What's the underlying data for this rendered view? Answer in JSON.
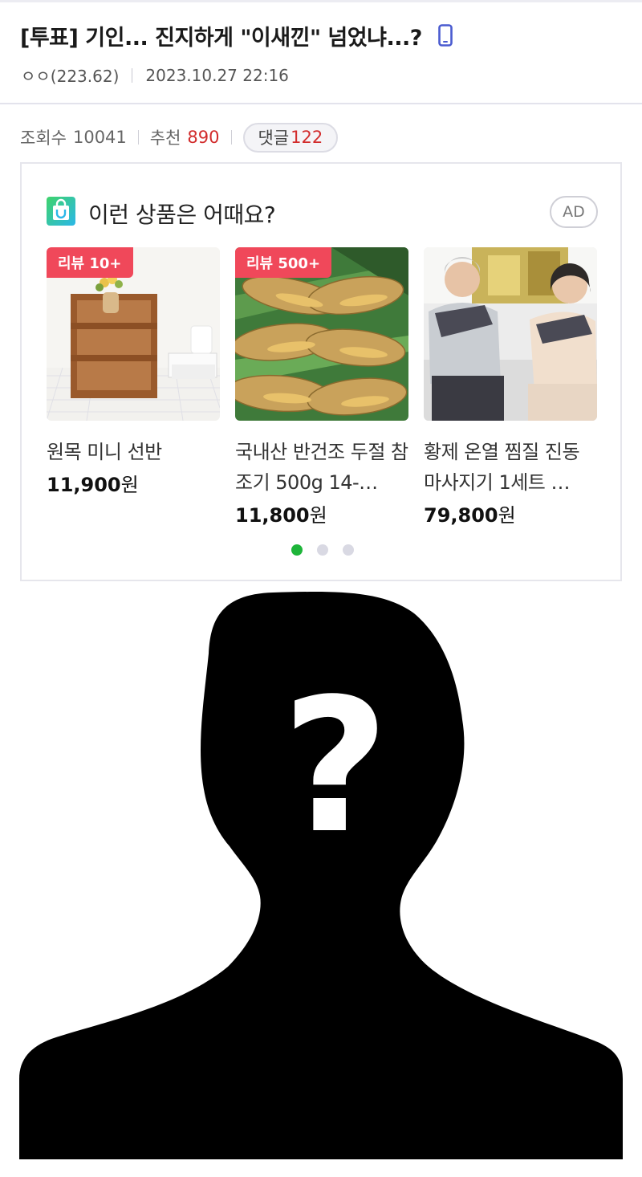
{
  "post": {
    "title": "[투표] 기인... 진지하게 \"이새낀\" 넘었냐...?",
    "author": "ㅇㅇ(223.62)",
    "datetime": "2023.10.27 22:16",
    "device_icon": "mobile-phone-icon"
  },
  "stats": {
    "views_label": "조회수",
    "views": "10041",
    "recommend_label": "추천",
    "recommend": "890",
    "comments_label": "댓글",
    "comments": "122"
  },
  "ad": {
    "title": "이런 상품은 어때요?",
    "badge": "AD",
    "logo_icon": "shopping-bag-icon",
    "products": [
      {
        "tag": "리뷰 10+",
        "name": "원목 미니 선반",
        "price": "11,900",
        "currency": "원",
        "image": "wooden-shelf"
      },
      {
        "tag": "리뷰 500+",
        "name": "국내산 반건조 두절 참조기 500g 14-…",
        "price": "11,800",
        "currency": "원",
        "image": "dried-yellow-croaker"
      },
      {
        "tag": "",
        "name": "황제 온열 찜질 진동 마사지기 1세트 …",
        "price": "79,800",
        "currency": "원",
        "image": "elderly-couple-massager"
      }
    ],
    "carousel": {
      "pages": 3,
      "active": 0
    }
  },
  "colors": {
    "accent_red": "#d22c2c",
    "tag_red": "#f0485a",
    "dot_active": "#1eb53a"
  },
  "body_image": {
    "icon": "anonymous-person-silhouette-icon",
    "glyph": "?"
  }
}
